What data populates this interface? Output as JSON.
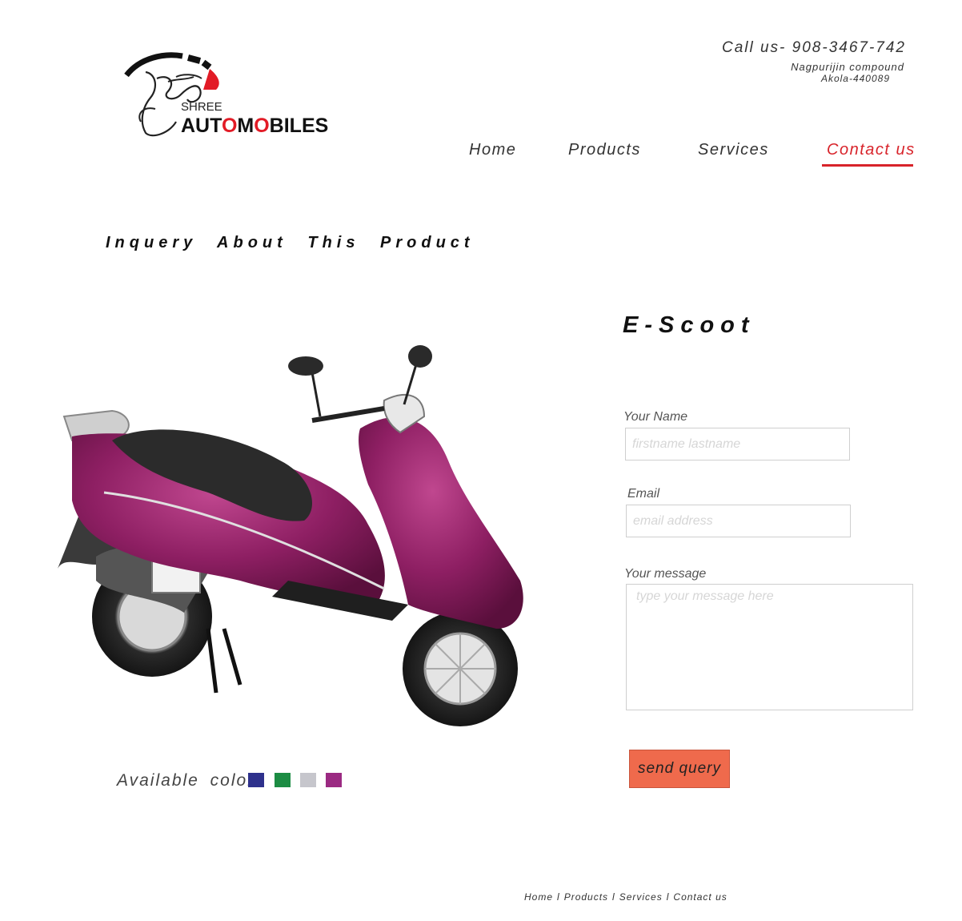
{
  "logo": {
    "small_text": "SHREE",
    "brand_pre": "AUT",
    "brand_o": "O",
    "brand_mid": "M",
    "brand_o2": "O",
    "brand_post": "BILES"
  },
  "header": {
    "call": "Call us- 908-3467-742",
    "address_line1": "Nagpurijin compound",
    "address_line2": "Akola-440089"
  },
  "nav": {
    "home": "Home",
    "products": "Products",
    "services": "Services",
    "contact": "Contact us",
    "active": "Contact us"
  },
  "page": {
    "heading": "Inquery About This Product",
    "product_title": "E-Scoot",
    "colors_label": "Available colors",
    "colors": [
      "#2e318c",
      "#1c8c43",
      "#c6c6cc",
      "#9b2a82"
    ],
    "scooter_color": "#8e1f63"
  },
  "form": {
    "name_label": "Your Name",
    "name_placeholder": "firstname lastname",
    "email_label": "Email",
    "email_placeholder": "email address",
    "message_label": "Your message",
    "message_placeholder": "type your message here",
    "submit_label": "send query"
  },
  "footer": {
    "links": [
      "Home",
      "Products",
      "Services",
      "Contact us"
    ],
    "separator": "l"
  }
}
